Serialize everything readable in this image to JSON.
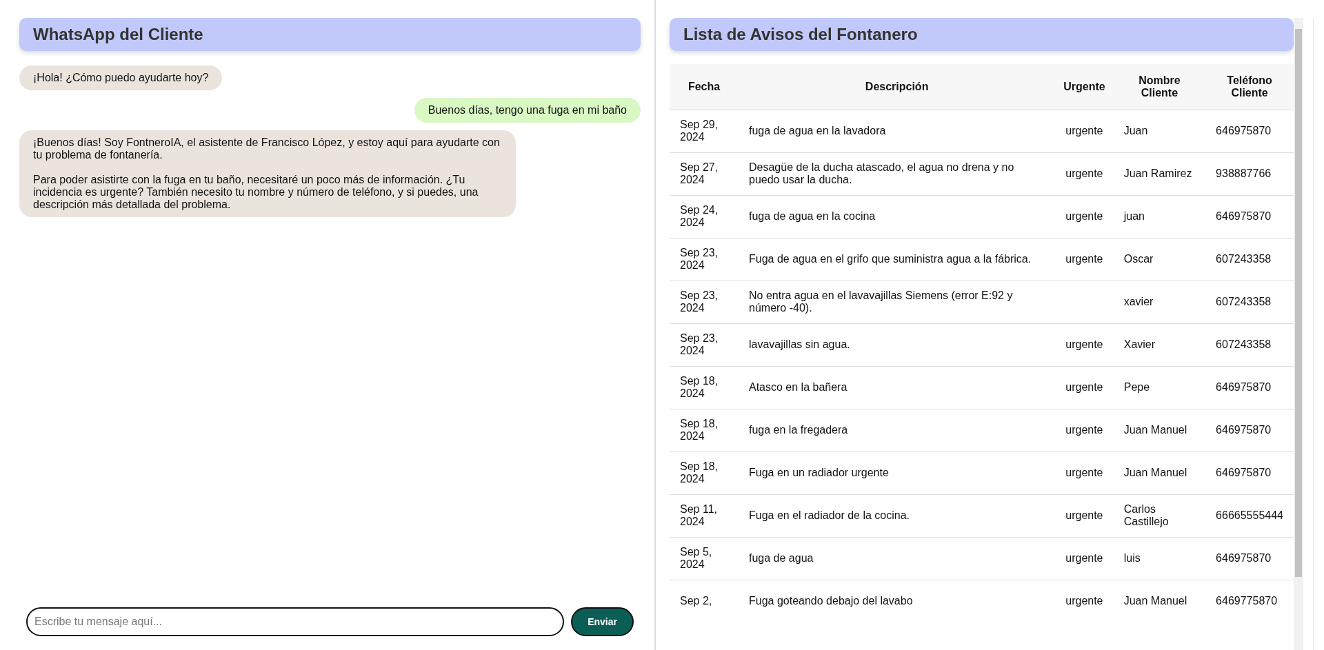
{
  "chat": {
    "title": "WhatsApp del Cliente",
    "messages": [
      {
        "kind": "bot",
        "paragraphs": [
          "¡Hola! ¿Cómo puedo ayudarte hoy?"
        ]
      },
      {
        "kind": "user",
        "paragraphs": [
          "Buenos días, tengo una fuga en mi baño"
        ]
      },
      {
        "kind": "bot",
        "paragraphs": [
          "¡Buenos días! Soy FontneroIA, el asistente de Francisco López, y estoy aquí para ayudarte con tu problema de fontanería.",
          "Para poder asistirte con la fuga en tu baño, necesitaré un poco más de información. ¿Tu incidencia es urgente? También necesito tu nombre y número de teléfono, y si puedes, una descripción más detallada del problema."
        ]
      }
    ],
    "input": {
      "placeholder": "Escribe tu mensaje aquí..."
    },
    "send_button": "Enviar"
  },
  "notices": {
    "title": "Lista de Avisos del Fontanero",
    "columns": [
      "Fecha",
      "Descripción",
      "Urgente",
      "Nombre Cliente",
      "Teléfono Cliente"
    ],
    "rows": [
      [
        "Sep 29, 2024",
        "fuga de agua en la lavadora",
        "urgente",
        "Juan",
        "646975870"
      ],
      [
        "Sep 27, 2024",
        "Desagüe de la ducha atascado, el agua no drena y no puedo usar la ducha.",
        "urgente",
        "Juan Ramirez",
        "938887766"
      ],
      [
        "Sep 24, 2024",
        "fuga de agua en la cocina",
        "urgente",
        "juan",
        "646975870"
      ],
      [
        "Sep 23, 2024",
        "Fuga de agua en el grifo que suministra agua a la fábrica.",
        "urgente",
        "Oscar",
        "607243358"
      ],
      [
        "Sep 23, 2024",
        "No entra agua en el lavavajillas Siemens (error E:92 y número -40).",
        "",
        "xavier",
        "607243358"
      ],
      [
        "Sep 23, 2024",
        "lavavajillas sin agua.",
        "urgente",
        "Xavier",
        "607243358"
      ],
      [
        "Sep 18, 2024",
        "Atasco en la bañera",
        "urgente",
        "Pepe",
        "646975870"
      ],
      [
        "Sep 18, 2024",
        "fuga en la fregadera",
        "urgente",
        "Juan Manuel",
        "646975870"
      ],
      [
        "Sep 18, 2024",
        "Fuga en un radiador urgente",
        "urgente",
        "Juan Manuel",
        "646975870"
      ],
      [
        "Sep 11, 2024",
        "Fuga en el radiador de la cocina.",
        "urgente",
        "Carlos Castillejo",
        "66665555444"
      ],
      [
        "Sep 5, 2024",
        "fuga de agua",
        "urgente",
        "luis",
        "646975870"
      ],
      [
        "Sep 2,",
        "Fuga goteando debajo del lavabo",
        "urgente",
        "Juan Manuel",
        "6469775870"
      ]
    ]
  }
}
